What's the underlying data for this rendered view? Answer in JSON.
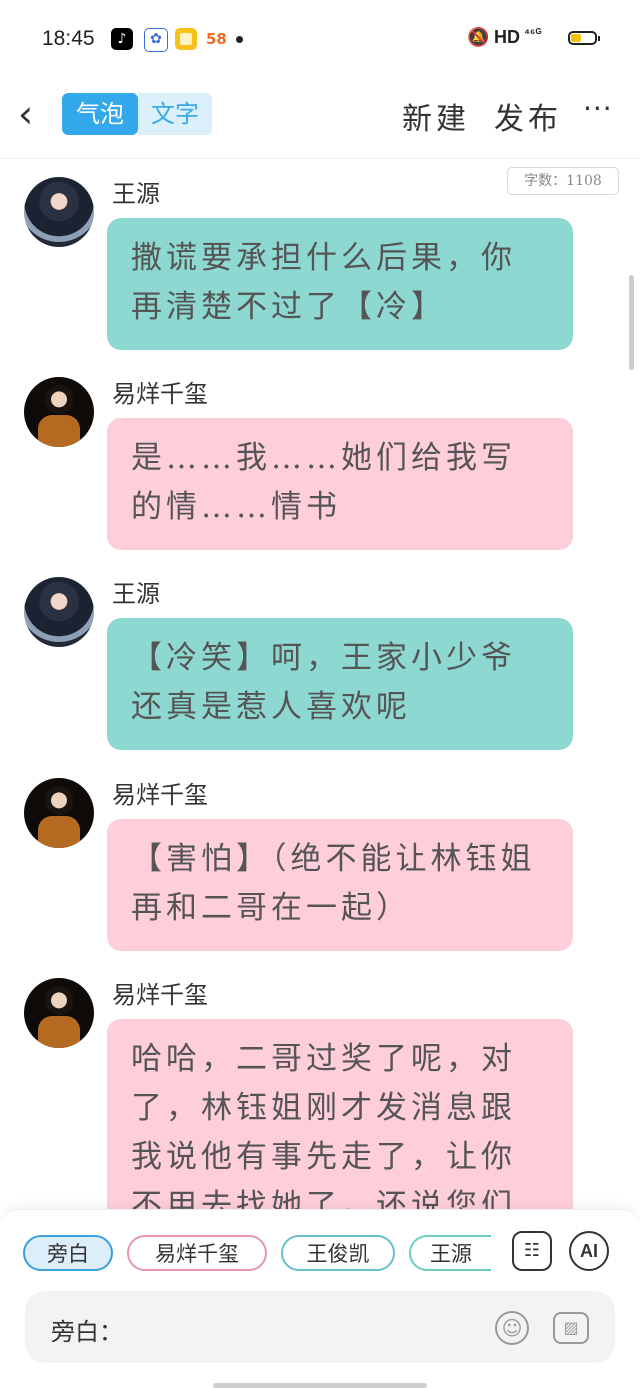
{
  "status": {
    "time": "18:45",
    "apps": [
      "tiktok-icon",
      "baidu-icon",
      "notes-icon",
      "58-icon"
    ],
    "app58": "58",
    "hd": "HD",
    "signal": "⁴⁶ᴳ"
  },
  "nav": {
    "back": "‹",
    "tab_bubble": "气泡",
    "tab_text": "文字",
    "new": "新建",
    "publish": "发布",
    "more": "···"
  },
  "word_count": "字数：1108",
  "messages": [
    {
      "name": "王源",
      "text": "撒谎要承担什么后果，你再清楚不过了【冷】",
      "style": "teal"
    },
    {
      "name": "易烊千玺",
      "text": "是……我……她们给我写的情……情书",
      "style": "pink"
    },
    {
      "name": "王源",
      "text": "【冷笑】呵，王家小少爷还真是惹人喜欢呢",
      "style": "teal"
    },
    {
      "name": "易烊千玺",
      "text": "【害怕】（绝不能让林钰姐再和二哥在一起）",
      "style": "pink"
    },
    {
      "name": "易烊千玺",
      "text": "哈哈，二哥过奖了呢，对了，林钰姐刚才发消息跟我说他有事先走了，让你不用去找她了，还说您们",
      "style": "pink"
    }
  ],
  "roles": [
    "旁白",
    "易烊千玺",
    "王俊凯",
    "王源"
  ],
  "tools": {
    "contact": "☷",
    "ai": "AI"
  },
  "input": {
    "label": "旁白：",
    "emoji": "☺",
    "image": "▨"
  },
  "colors": {
    "teal": "#8dd8d0",
    "pink": "#ffcedb",
    "accent": "#33a8ea"
  }
}
